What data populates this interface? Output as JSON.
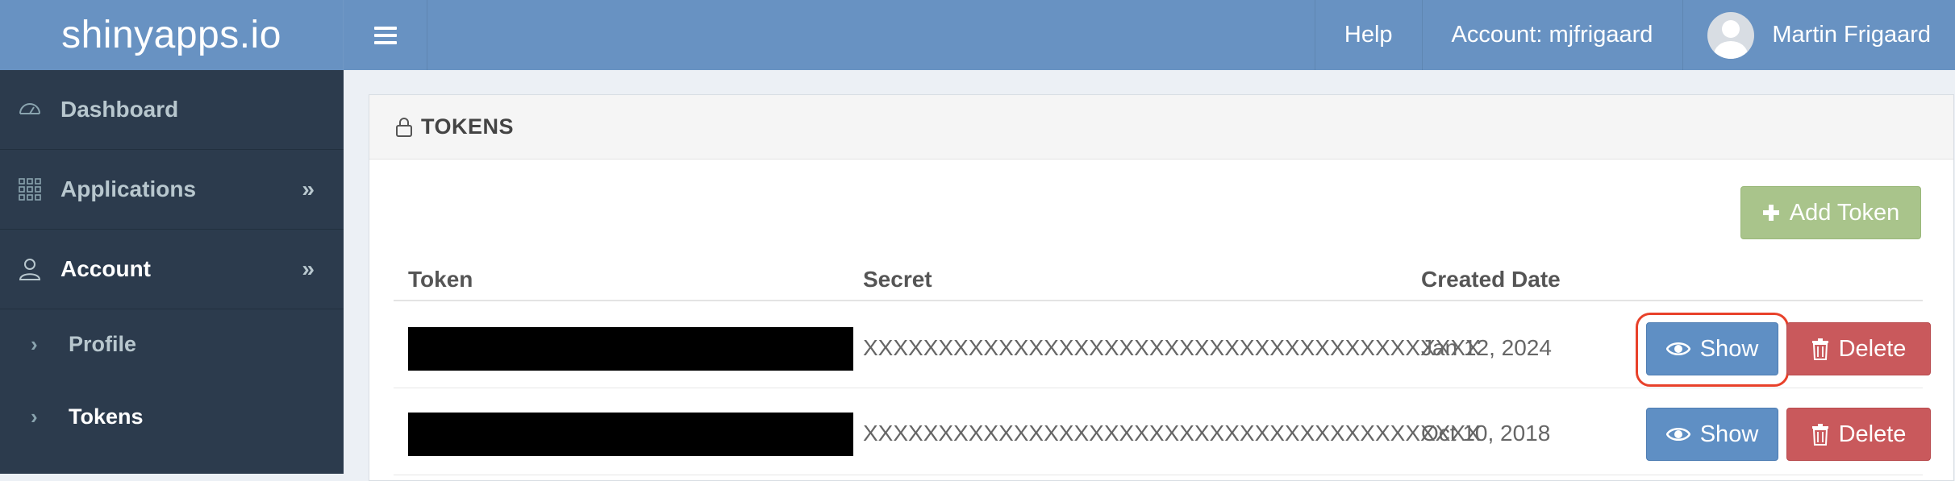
{
  "header": {
    "brand": "shinyapps.io",
    "help": "Help",
    "account_label": "Account:  mjfrigaard",
    "user_name": "Martin Frigaard"
  },
  "sidebar": {
    "items": [
      {
        "label": "Dashboard",
        "icon": "dashboard-icon"
      },
      {
        "label": "Applications",
        "icon": "grid-icon",
        "chevron": "»"
      },
      {
        "label": "Account",
        "icon": "user-icon",
        "chevron": "»"
      }
    ],
    "subitems": [
      {
        "label": "Profile",
        "arrow": "›"
      },
      {
        "label": "Tokens",
        "arrow": "›",
        "active": true
      }
    ]
  },
  "main": {
    "panel_title": "TOKENS",
    "add_button": "Add Token",
    "columns": [
      "Token",
      "Secret",
      "Created Date"
    ],
    "rows": [
      {
        "secret": "XXXXXXXXXXXXXXXXXXXXXXXXXXXXXXXXXXXXXXXXX",
        "created": "Jan 12, 2024",
        "show": "Show",
        "delete": "Delete"
      },
      {
        "secret": "XXXXXXXXXXXXXXXXXXXXXXXXXXXXXXXXXXXXXXXXX",
        "created": "Oct 10, 2018",
        "show": "Show",
        "delete": "Delete"
      }
    ]
  },
  "colors": {
    "topbar": "#6892c2",
    "sidebar": "#2c3b4d",
    "add_button": "#a9c48b",
    "show_button": "#5f8fc4",
    "delete_button": "#c9595c",
    "highlight": "#e8412a"
  }
}
